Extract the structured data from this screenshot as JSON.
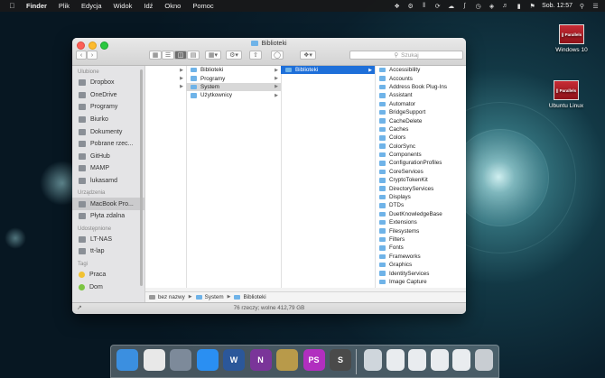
{
  "menubar": {
    "items": [
      "Finder",
      "Plik",
      "Edycja",
      "Widok",
      "Idź",
      "Okno",
      "Pomoc"
    ],
    "clock": "Sob. 12:57"
  },
  "window": {
    "title": "Biblioteki",
    "search_placeholder": "Szukaj",
    "status": "76 rzeczy; wolne 412,79 GB"
  },
  "sidebar": {
    "favorites_header": "Ulubione",
    "favorites": [
      {
        "label": "Dropbox",
        "icon": "dropbox-icon"
      },
      {
        "label": "OneDrive",
        "icon": "cloud-icon"
      },
      {
        "label": "Programy",
        "icon": "applications-icon"
      },
      {
        "label": "Biurko",
        "icon": "desktop-icon"
      },
      {
        "label": "Dokumenty",
        "icon": "documents-icon"
      },
      {
        "label": "Pobrane rzec...",
        "icon": "downloads-icon"
      },
      {
        "label": "GitHub",
        "icon": "folder-icon"
      },
      {
        "label": "MAMP",
        "icon": "folder-icon"
      },
      {
        "label": "lukasamd",
        "icon": "home-icon"
      }
    ],
    "devices_header": "Urządzenia",
    "devices": [
      {
        "label": "MacBook Pro...",
        "icon": "laptop-icon"
      },
      {
        "label": "Płyta zdalna",
        "icon": "disc-icon"
      }
    ],
    "shared_header": "Udostępnione",
    "shared": [
      {
        "label": "LT-NAS",
        "icon": "server-icon"
      },
      {
        "label": "tt-lap",
        "icon": "computer-icon"
      }
    ],
    "tags_header": "Tagi",
    "tags": [
      {
        "label": "Praca",
        "color": "#f1c232"
      },
      {
        "label": "Dom",
        "color": "#7cc542"
      }
    ]
  },
  "columns": {
    "col2": [
      "Biblioteki",
      "Programy",
      "System",
      "Użytkownicy"
    ],
    "col3": [
      "Biblioteki"
    ],
    "col4": [
      "Accessibility",
      "Accounts",
      "Address Book Plug-Ins",
      "Assistant",
      "Automator",
      "BridgeSupport",
      "CacheDelete",
      "Caches",
      "Colors",
      "ColorSync",
      "Components",
      "ConfigurationProfiles",
      "CoreServices",
      "CryptoTokenKit",
      "DirectoryServices",
      "Displays",
      "DTDs",
      "DuetKnowledgeBase",
      "Extensions",
      "Filesystems",
      "Filters",
      "Fonts",
      "Frameworks",
      "Graphics",
      "IdentityServices",
      "Image Capture"
    ]
  },
  "pathbar": [
    "bez nazwy",
    "System",
    "Biblioteki"
  ],
  "desktop_icons": [
    {
      "label": "Windows 10",
      "badge": "|| Parallels"
    },
    {
      "label": "Ubuntu Linux",
      "badge": "|| Parallels"
    }
  ],
  "dock": {
    "apps": [
      {
        "name": "finder-icon",
        "color": "#3b8fe0"
      },
      {
        "name": "chrome-icon",
        "color": "#e8e8e8"
      },
      {
        "name": "launchpad-icon",
        "color": "#7d8a9a"
      },
      {
        "name": "safari-icon",
        "color": "#2a8ff2"
      },
      {
        "name": "word-icon",
        "color": "#2b579a",
        "glyph": "W"
      },
      {
        "name": "onenote-icon",
        "color": "#7a3599",
        "glyph": "N"
      },
      {
        "name": "archive-icon",
        "color": "#b89a4a"
      },
      {
        "name": "phpstorm-icon",
        "color": "#b12fbf",
        "glyph": "PS"
      },
      {
        "name": "sublime-icon",
        "color": "#4a4a4a",
        "glyph": "S"
      }
    ],
    "docs": [
      {
        "name": "document-icon",
        "color": "#cfd6dc"
      },
      {
        "name": "window-thumbnail-icon",
        "color": "#e9ecef"
      },
      {
        "name": "window-thumbnail-icon",
        "color": "#e9ecef"
      },
      {
        "name": "window-thumbnail-icon",
        "color": "#e9ecef"
      },
      {
        "name": "window-thumbnail-icon",
        "color": "#e9ecef"
      },
      {
        "name": "trash-icon",
        "color": "#c8cdd2"
      }
    ]
  }
}
